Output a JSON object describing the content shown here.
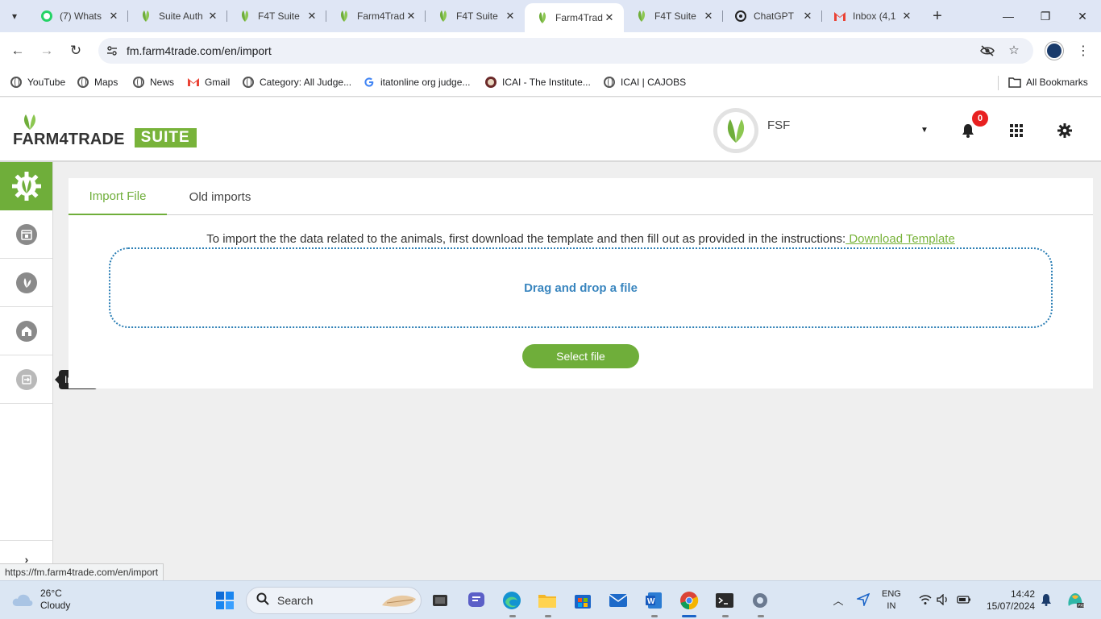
{
  "browser": {
    "tabs": [
      {
        "title": "(7) Whats",
        "icon": "whatsapp-icon",
        "active": false
      },
      {
        "title": "Suite Auth",
        "icon": "leaf-icon",
        "active": false
      },
      {
        "title": "F4T Suite",
        "icon": "leaf-icon",
        "active": false
      },
      {
        "title": "Farm4Trad",
        "icon": "leaf-icon",
        "active": false
      },
      {
        "title": "F4T Suite",
        "icon": "leaf-icon",
        "active": false
      },
      {
        "title": "Farm4Trad",
        "icon": "leaf-icon",
        "active": true
      },
      {
        "title": "F4T Suite",
        "icon": "leaf-icon",
        "active": false
      },
      {
        "title": "ChatGPT",
        "icon": "chatgpt-icon",
        "active": false
      },
      {
        "title": "Inbox (4,1",
        "icon": "gmail-icon",
        "active": false
      }
    ],
    "url": "fm.farm4trade.com/en/import",
    "bookmarks": [
      {
        "label": "YouTube",
        "icon": "globe-icon"
      },
      {
        "label": "Maps",
        "icon": "globe-icon"
      },
      {
        "label": "News",
        "icon": "globe-icon"
      },
      {
        "label": "Gmail",
        "icon": "gmail-icon"
      },
      {
        "label": "Category: All Judge...",
        "icon": "globe-icon"
      },
      {
        "label": "itatonline org judge...",
        "icon": "google-icon"
      },
      {
        "label": "ICAI - The Institute...",
        "icon": "icai-icon"
      },
      {
        "label": "ICAI | CAJOBS",
        "icon": "globe-icon"
      }
    ],
    "all_bookmarks": "All Bookmarks",
    "status_url": "https://fm.farm4trade.com/en/import"
  },
  "app": {
    "logo_word": "FARM4TRADE",
    "logo_suite": "SUITE",
    "user_name": "FSF",
    "notification_count": "0",
    "brand_color": "#6fae3a",
    "sidenav": [
      {
        "name": "settings",
        "icon": "gear-icon",
        "active": true
      },
      {
        "name": "calendar",
        "icon": "calendar-icon",
        "active": false
      },
      {
        "name": "farm",
        "icon": "plant-icon",
        "active": false
      },
      {
        "name": "animals",
        "icon": "barn-icon",
        "active": false
      },
      {
        "name": "import",
        "icon": "import-icon",
        "active": false
      }
    ],
    "tooltip": "Import"
  },
  "main": {
    "tabs": [
      {
        "label": "Import File",
        "active": true
      },
      {
        "label": "Old imports",
        "active": false
      }
    ],
    "instructions": "To import the the data related to the animals, first download the template and then fill out as provided in the instructions:",
    "download_link": " Download Template",
    "dropzone_text": "Drag and drop a file",
    "select_button": "Select file"
  },
  "taskbar": {
    "weather_temp": "26°C",
    "weather_desc": "Cloudy",
    "search_placeholder": "Search",
    "lang_line1": "ENG",
    "lang_line2": "IN",
    "time": "14:42",
    "date": "15/07/2024"
  }
}
